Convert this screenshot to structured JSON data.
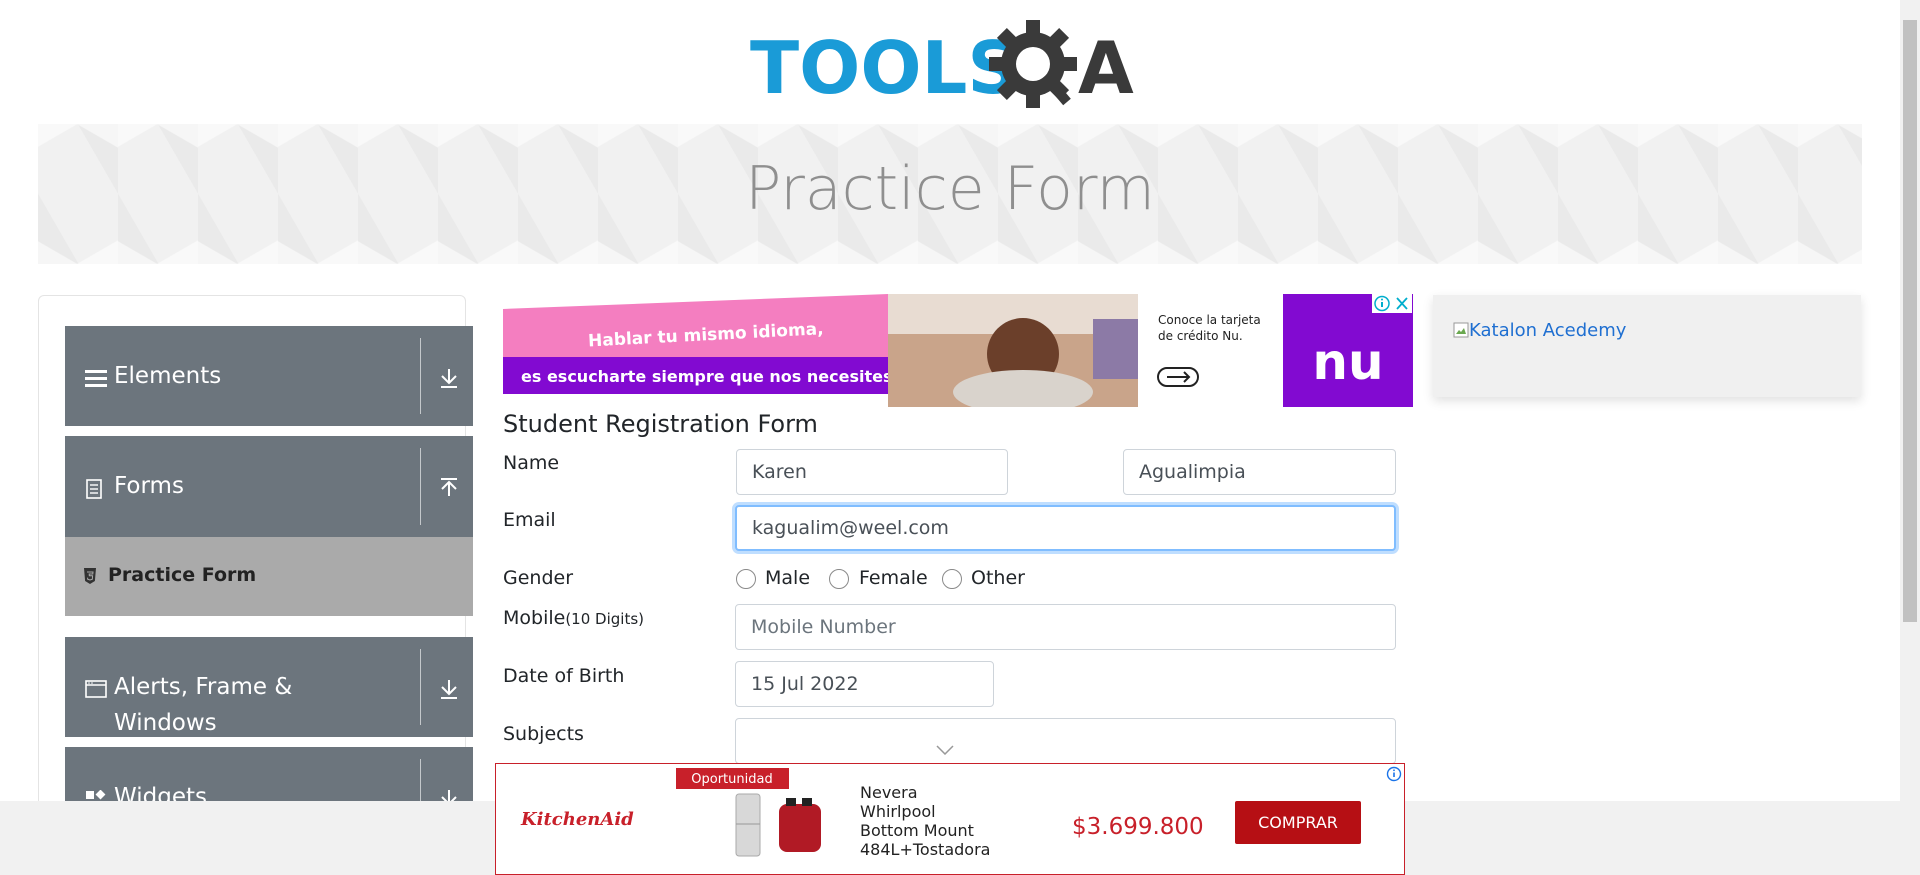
{
  "logo": {
    "text_left": "TOOLS",
    "text_right": "A"
  },
  "page": {
    "title": "Practice Form"
  },
  "sidebar": {
    "groups": [
      {
        "label": "Elements",
        "icon": "hamburger-icon",
        "arrow": "download-icon"
      },
      {
        "label": "Forms",
        "icon": "document-icon",
        "arrow": "upload-icon"
      },
      {
        "label_line1": "Alerts, Frame &",
        "label_line2": "Windows",
        "icon": "window-icon",
        "arrow": "download-icon"
      },
      {
        "label": "Widgets",
        "icon": "widgets-icon",
        "arrow": "download-icon"
      }
    ],
    "active_item": {
      "label": "Practice Form",
      "icon": "html5-icon"
    }
  },
  "ad_top": {
    "line1": "Hablar tu mismo idioma,",
    "line2": "es escucharte siempre que nos necesites.",
    "caption_line1": "Conoce la tarjeta",
    "caption_line2": "de crédito Nu.",
    "brand": "nu"
  },
  "ad_right": {
    "alt_text": "Katalon Acedemy"
  },
  "form": {
    "title": "Student Registration Form",
    "name_label": "Name",
    "first_name": "Karen",
    "last_name": "Agualimpia",
    "email_label": "Email",
    "email": "kagualim@weel.com",
    "gender_label": "Gender",
    "gender_options": [
      "Male",
      "Female",
      "Other"
    ],
    "mobile_label": "Mobile",
    "mobile_hint": "(10 Digits)",
    "mobile_placeholder": "Mobile Number",
    "dob_label": "Date of Birth",
    "dob": "15 Jul 2022",
    "subjects_label": "Subjects"
  },
  "ad_bottom": {
    "brand": "KitchenAid",
    "badge": "Oportunidad",
    "product_line1": "Nevera",
    "product_line2": "Whirlpool",
    "product_line3": "Bottom Mount",
    "product_line4": "484L+Tostadora",
    "price": "$3.699.800",
    "cta": "COMPRAR"
  },
  "colors": {
    "sidebar_group": "#6c757d",
    "active_item": "#aaaaaa",
    "ad_red": "#c8202a",
    "logo_blue": "#1a9bd7"
  }
}
